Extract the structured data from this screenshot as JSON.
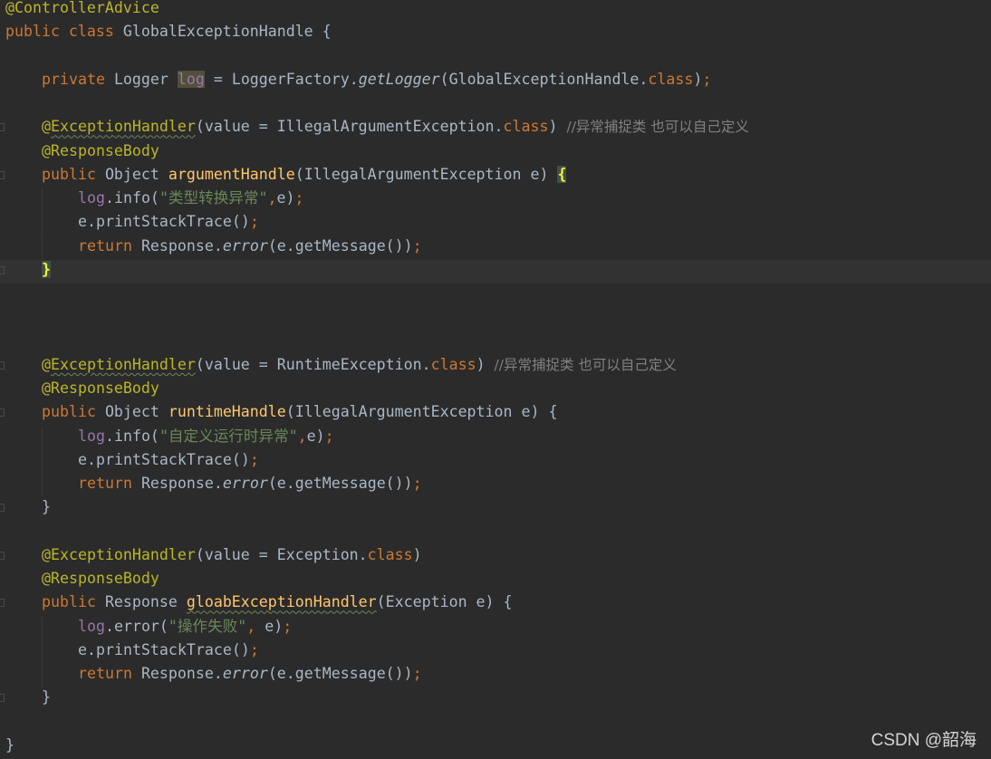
{
  "editor": {
    "lines": [
      {
        "fold": false,
        "current": false,
        "indent": 0,
        "tokens": [
          {
            "t": "@ControllerAdvice",
            "c": "ann"
          }
        ]
      },
      {
        "fold": false,
        "current": false,
        "indent": 0,
        "tokens": [
          {
            "t": "public class ",
            "c": "kw"
          },
          {
            "t": "GlobalExceptionHandle {",
            "c": "plain"
          }
        ]
      },
      {
        "fold": false,
        "current": false,
        "indent": 0,
        "tokens": []
      },
      {
        "fold": false,
        "current": false,
        "indent": 1,
        "tokens": [
          {
            "t": "private ",
            "c": "kw"
          },
          {
            "t": "Logger ",
            "c": "plain"
          },
          {
            "t": "log",
            "c": "field",
            "hl": true
          },
          {
            "t": " = LoggerFactory.",
            "c": "plain"
          },
          {
            "t": "getLogger",
            "c": "italic"
          },
          {
            "t": "(GlobalExceptionHandle.",
            "c": "plain"
          },
          {
            "t": "class",
            "c": "kw"
          },
          {
            "t": ")",
            "c": "plain"
          },
          {
            "t": ";",
            "c": "kw"
          }
        ]
      },
      {
        "fold": false,
        "current": false,
        "indent": 0,
        "tokens": []
      },
      {
        "fold": true,
        "current": false,
        "indent": 1,
        "tokens": [
          {
            "t": "@",
            "c": "ann"
          },
          {
            "t": "ExceptionHandler",
            "c": "ann",
            "wavy": true
          },
          {
            "t": "(value = IllegalArgumentException.",
            "c": "plain"
          },
          {
            "t": "class",
            "c": "kw"
          },
          {
            "t": ") ",
            "c": "plain"
          },
          {
            "t": "//异常捕捉类 也可以自己定义",
            "c": "comment"
          }
        ]
      },
      {
        "fold": false,
        "current": false,
        "indent": 1,
        "tokens": [
          {
            "t": "@ResponseBody",
            "c": "ann"
          }
        ]
      },
      {
        "fold": true,
        "current": false,
        "indent": 1,
        "tokens": [
          {
            "t": "public ",
            "c": "kw"
          },
          {
            "t": "Object ",
            "c": "plain"
          },
          {
            "t": "argumentHandle",
            "c": "method"
          },
          {
            "t": "(IllegalArgumentException e) ",
            "c": "plain"
          },
          {
            "t": "{",
            "c": "bracehl"
          }
        ]
      },
      {
        "fold": false,
        "current": false,
        "indent": 2,
        "tokens": [
          {
            "t": "log",
            "c": "field"
          },
          {
            "t": ".info(",
            "c": "plain"
          },
          {
            "t": "\"类型转换异常\"",
            "c": "str"
          },
          {
            "t": ",",
            "c": "kw"
          },
          {
            "t": "e)",
            "c": "plain"
          },
          {
            "t": ";",
            "c": "kw"
          }
        ]
      },
      {
        "fold": false,
        "current": false,
        "indent": 2,
        "tokens": [
          {
            "t": "e.printStackTrace()",
            "c": "plain"
          },
          {
            "t": ";",
            "c": "kw"
          }
        ]
      },
      {
        "fold": false,
        "current": false,
        "indent": 2,
        "tokens": [
          {
            "t": "return ",
            "c": "kw"
          },
          {
            "t": "Response.",
            "c": "plain"
          },
          {
            "t": "error",
            "c": "italic"
          },
          {
            "t": "(e.getMessage())",
            "c": "plain"
          },
          {
            "t": ";",
            "c": "kw"
          }
        ]
      },
      {
        "fold": true,
        "current": true,
        "indent": 1,
        "tokens": [
          {
            "t": "}",
            "c": "bracehl"
          }
        ]
      },
      {
        "fold": false,
        "current": false,
        "indent": 0,
        "tokens": []
      },
      {
        "fold": false,
        "current": false,
        "indent": 0,
        "tokens": []
      },
      {
        "fold": false,
        "current": false,
        "indent": 0,
        "tokens": []
      },
      {
        "fold": true,
        "current": false,
        "indent": 1,
        "tokens": [
          {
            "t": "@",
            "c": "ann"
          },
          {
            "t": "ExceptionHandler",
            "c": "ann",
            "wavy": true
          },
          {
            "t": "(value = RuntimeException.",
            "c": "plain"
          },
          {
            "t": "class",
            "c": "kw"
          },
          {
            "t": ") ",
            "c": "plain"
          },
          {
            "t": "//异常捕捉类 也可以自己定义",
            "c": "comment"
          }
        ]
      },
      {
        "fold": false,
        "current": false,
        "indent": 1,
        "tokens": [
          {
            "t": "@ResponseBody",
            "c": "ann"
          }
        ]
      },
      {
        "fold": true,
        "current": false,
        "indent": 1,
        "tokens": [
          {
            "t": "public ",
            "c": "kw"
          },
          {
            "t": "Object ",
            "c": "plain"
          },
          {
            "t": "runtimeHandle",
            "c": "method"
          },
          {
            "t": "(IllegalArgumentException e) {",
            "c": "plain"
          }
        ]
      },
      {
        "fold": false,
        "current": false,
        "indent": 2,
        "tokens": [
          {
            "t": "log",
            "c": "field"
          },
          {
            "t": ".info(",
            "c": "plain"
          },
          {
            "t": "\"自定义运行时异常\"",
            "c": "str"
          },
          {
            "t": ",",
            "c": "kw"
          },
          {
            "t": "e)",
            "c": "plain"
          },
          {
            "t": ";",
            "c": "kw"
          }
        ]
      },
      {
        "fold": false,
        "current": false,
        "indent": 2,
        "tokens": [
          {
            "t": "e.printStackTrace()",
            "c": "plain"
          },
          {
            "t": ";",
            "c": "kw"
          }
        ]
      },
      {
        "fold": false,
        "current": false,
        "indent": 2,
        "tokens": [
          {
            "t": "return ",
            "c": "kw"
          },
          {
            "t": "Response.",
            "c": "plain"
          },
          {
            "t": "error",
            "c": "italic"
          },
          {
            "t": "(e.getMessage())",
            "c": "plain"
          },
          {
            "t": ";",
            "c": "kw"
          }
        ]
      },
      {
        "fold": true,
        "current": false,
        "indent": 1,
        "tokens": [
          {
            "t": "}",
            "c": "plain"
          }
        ]
      },
      {
        "fold": false,
        "current": false,
        "indent": 0,
        "tokens": []
      },
      {
        "fold": true,
        "current": false,
        "indent": 1,
        "tokens": [
          {
            "t": "@ExceptionHandler",
            "c": "ann"
          },
          {
            "t": "(value = Exception.",
            "c": "plain"
          },
          {
            "t": "class",
            "c": "kw"
          },
          {
            "t": ")",
            "c": "plain"
          }
        ]
      },
      {
        "fold": false,
        "current": false,
        "indent": 1,
        "tokens": [
          {
            "t": "@ResponseBody",
            "c": "ann"
          }
        ]
      },
      {
        "fold": true,
        "current": false,
        "indent": 1,
        "tokens": [
          {
            "t": "public ",
            "c": "kw"
          },
          {
            "t": "Response ",
            "c": "plain"
          },
          {
            "t": "gloabExceptionHandler",
            "c": "method",
            "wavy": true
          },
          {
            "t": "(Exception e) {",
            "c": "plain"
          }
        ]
      },
      {
        "fold": false,
        "current": false,
        "indent": 2,
        "tokens": [
          {
            "t": "log",
            "c": "field"
          },
          {
            "t": ".error(",
            "c": "plain"
          },
          {
            "t": "\"操作失败\"",
            "c": "str"
          },
          {
            "t": ", ",
            "c": "kw"
          },
          {
            "t": "e)",
            "c": "plain"
          },
          {
            "t": ";",
            "c": "kw"
          }
        ]
      },
      {
        "fold": false,
        "current": false,
        "indent": 2,
        "tokens": [
          {
            "t": "e.printStackTrace()",
            "c": "plain"
          },
          {
            "t": ";",
            "c": "kw"
          }
        ]
      },
      {
        "fold": false,
        "current": false,
        "indent": 2,
        "tokens": [
          {
            "t": "return ",
            "c": "kw"
          },
          {
            "t": "Response.",
            "c": "plain"
          },
          {
            "t": "error",
            "c": "italic"
          },
          {
            "t": "(e.getMessage())",
            "c": "plain"
          },
          {
            "t": ";",
            "c": "kw"
          }
        ]
      },
      {
        "fold": true,
        "current": false,
        "indent": 1,
        "tokens": [
          {
            "t": "}",
            "c": "plain"
          }
        ]
      },
      {
        "fold": false,
        "current": false,
        "indent": 0,
        "tokens": []
      },
      {
        "fold": false,
        "current": false,
        "indent": 0,
        "tokens": [
          {
            "t": "}",
            "c": "plain"
          }
        ]
      }
    ]
  },
  "watermark": {
    "text": "CSDN @韶海"
  },
  "colors": {
    "background": "#2b2b2b",
    "keyword": "#cc7832",
    "annotation": "#bbb529",
    "string": "#6a8759",
    "field": "#9876aa",
    "method": "#ffc66d",
    "comment": "#808080"
  }
}
